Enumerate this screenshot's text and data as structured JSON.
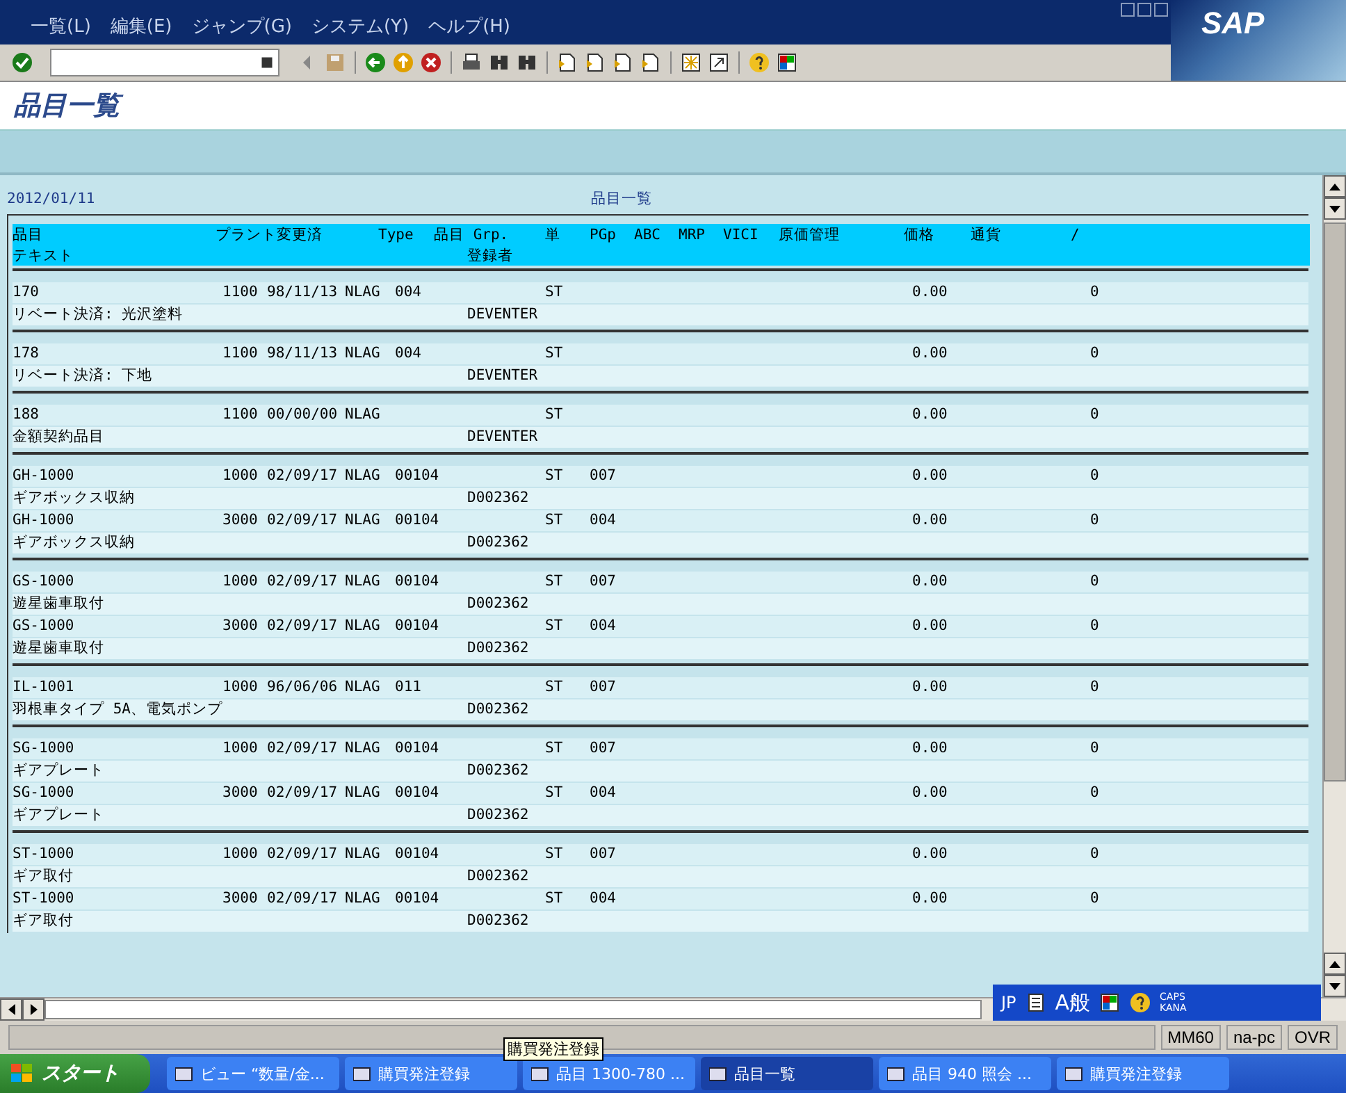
{
  "window": {
    "menu": [
      "一覧(L)",
      "編集(E)",
      "ジャンプ(G)",
      "システム(Y)",
      "ヘルプ(H)"
    ],
    "logo": "SAP"
  },
  "screen_title": "品目一覧",
  "report": {
    "date": "2012/01/11",
    "title": "品目一覧",
    "header_1": [
      "品目",
      "プラント変更済",
      "Type",
      "品目 Grp.",
      "単",
      "PGp",
      "ABC",
      "MRP",
      "VICI",
      "原価管理",
      "価格",
      "通貨",
      "/"
    ],
    "header_2": [
      "テキスト",
      "登録者"
    ],
    "groups": [
      [
        {
          "material": "170",
          "plant": "1100",
          "date": "98/11/13",
          "type": "NLAG",
          "group": "004",
          "unit": "ST",
          "price": "0.00",
          "currency": "0",
          "text": "リベート決済: 光沢塗料",
          "creator": "DEVENTER"
        }
      ],
      [
        {
          "material": "178",
          "plant": "1100",
          "date": "98/11/13",
          "type": "NLAG",
          "group": "004",
          "unit": "ST",
          "price": "0.00",
          "currency": "0",
          "text": "リベート決済: 下地",
          "creator": "DEVENTER"
        }
      ],
      [
        {
          "material": "188",
          "plant": "1100",
          "date": "00/00/00",
          "type": "NLAG",
          "unit": "ST",
          "price": "0.00",
          "currency": "0",
          "text": "金額契約品目",
          "creator": "DEVENTER"
        }
      ],
      [
        {
          "material": "GH-1000",
          "plant": "1000",
          "date": "02/09/17",
          "type": "NLAG",
          "group": "00104",
          "unit": "ST",
          "pgp": "007",
          "price": "0.00",
          "currency": "0",
          "text": "ギアボックス収納",
          "creator": "D002362"
        },
        {
          "material": "GH-1000",
          "plant": "3000",
          "date": "02/09/17",
          "type": "NLAG",
          "group": "00104",
          "unit": "ST",
          "pgp": "004",
          "price": "0.00",
          "currency": "0",
          "text": "ギアボックス収納",
          "creator": "D002362"
        }
      ],
      [
        {
          "material": "GS-1000",
          "plant": "1000",
          "date": "02/09/17",
          "type": "NLAG",
          "group": "00104",
          "unit": "ST",
          "pgp": "007",
          "price": "0.00",
          "currency": "0",
          "text": "遊星歯車取付",
          "creator": "D002362"
        },
        {
          "material": "GS-1000",
          "plant": "3000",
          "date": "02/09/17",
          "type": "NLAG",
          "group": "00104",
          "unit": "ST",
          "pgp": "004",
          "price": "0.00",
          "currency": "0",
          "text": "遊星歯車取付",
          "creator": "D002362"
        }
      ],
      [
        {
          "material": "IL-1001",
          "plant": "1000",
          "date": "96/06/06",
          "type": "NLAG",
          "group": "011",
          "unit": "ST",
          "pgp": "007",
          "price": "0.00",
          "currency": "0",
          "text": "羽根車タイプ 5A、電気ポンプ",
          "creator": "D002362"
        }
      ],
      [
        {
          "material": "SG-1000",
          "plant": "1000",
          "date": "02/09/17",
          "type": "NLAG",
          "group": "00104",
          "unit": "ST",
          "pgp": "007",
          "price": "0.00",
          "currency": "0",
          "text": "ギアプレート",
          "creator": "D002362"
        },
        {
          "material": "SG-1000",
          "plant": "3000",
          "date": "02/09/17",
          "type": "NLAG",
          "group": "00104",
          "unit": "ST",
          "pgp": "004",
          "price": "0.00",
          "currency": "0",
          "text": "ギアプレート",
          "creator": "D002362"
        }
      ],
      [
        {
          "material": "ST-1000",
          "plant": "1000",
          "date": "02/09/17",
          "type": "NLAG",
          "group": "00104",
          "unit": "ST",
          "pgp": "007",
          "price": "0.00",
          "currency": "0",
          "text": "ギア取付",
          "creator": "D002362"
        },
        {
          "material": "ST-1000",
          "plant": "3000",
          "date": "02/09/17",
          "type": "NLAG",
          "group": "00104",
          "unit": "ST",
          "pgp": "004",
          "price": "0.00",
          "currency": "0",
          "text": "ギア取付",
          "creator": "D002362"
        }
      ]
    ]
  },
  "ime_bar": {
    "language": "JP",
    "mode": "A般",
    "caps": "CAPS",
    "kana": "KANA"
  },
  "status_bar": {
    "transaction": "MM60",
    "host": "na-pc",
    "mode": "OVR"
  },
  "tooltip": "購買発注登録",
  "taskbar": {
    "start": "スタート",
    "items": [
      {
        "label": "ビュー “数量/金...",
        "selected": false
      },
      {
        "label": "購買発注登録",
        "selected": false
      },
      {
        "label": "品目 1300-780 ...",
        "selected": false
      },
      {
        "label": "品目一覧",
        "selected": true
      },
      {
        "label": "品目 940 照会 ...",
        "selected": false
      },
      {
        "label": "購買発注登録",
        "selected": false
      }
    ]
  }
}
